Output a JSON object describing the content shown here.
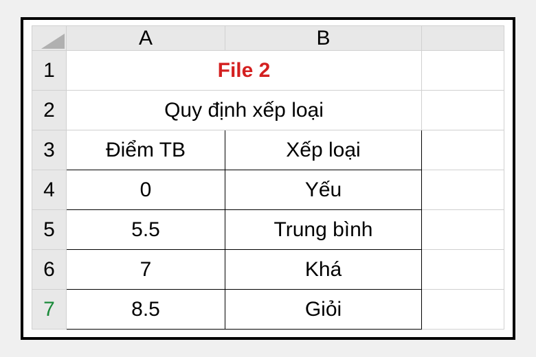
{
  "columns": [
    "A",
    "B"
  ],
  "rows": [
    "1",
    "2",
    "3",
    "4",
    "5",
    "6",
    "7"
  ],
  "active_row_index": 6,
  "title": "File 2",
  "subtitle": "Quy định xếp loại",
  "headers": {
    "col_a": "Điểm TB",
    "col_b": "Xếp loại"
  },
  "data_rows": [
    {
      "a": "0",
      "b": "Yếu"
    },
    {
      "a": "5.5",
      "b": "Trung bình"
    },
    {
      "a": "7",
      "b": "Khá"
    },
    {
      "a": "8.5",
      "b": "Giỏi"
    }
  ],
  "chart_data": {
    "type": "table",
    "title": "Quy định xếp loại",
    "columns": [
      "Điểm TB",
      "Xếp loại"
    ],
    "rows": [
      [
        0,
        "Yếu"
      ],
      [
        5.5,
        "Trung bình"
      ],
      [
        7,
        "Khá"
      ],
      [
        8.5,
        "Giỏi"
      ]
    ]
  }
}
